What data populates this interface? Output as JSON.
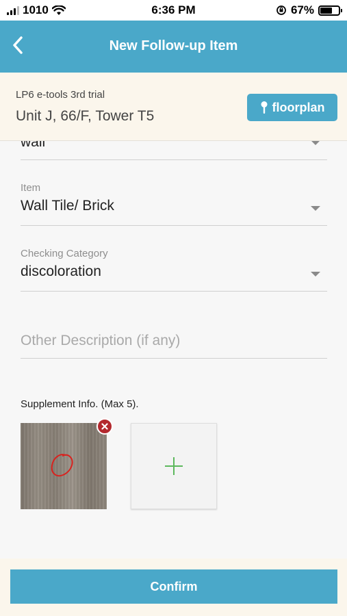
{
  "status_bar": {
    "carrier": "1010",
    "time": "6:36 PM",
    "battery_percent": "67%",
    "battery_level": 0.67
  },
  "nav": {
    "title": "New Follow-up Item",
    "back_icon": "chevron-left-icon"
  },
  "project": {
    "name": "LP6 e-tools 3rd trial",
    "unit": "Unit J, 66/F, Tower T5",
    "floorplan_label": "floorplan",
    "floorplan_icon": "pin-icon"
  },
  "form": {
    "location": {
      "value": "wall"
    },
    "item": {
      "label": "Item",
      "value": "Wall Tile/ Brick"
    },
    "checking_category": {
      "label": "Checking Category",
      "value": "discoloration"
    },
    "other_description": {
      "placeholder": "Other Description (if any)"
    },
    "supplement": {
      "label": "Supplement Info. (Max 5)."
    }
  },
  "footer": {
    "confirm_label": "Confirm"
  },
  "colors": {
    "accent": "#4aa8c9",
    "header_bg": "#fbf6ec",
    "remove_red": "#b3292e",
    "add_green": "#5cb85c"
  }
}
